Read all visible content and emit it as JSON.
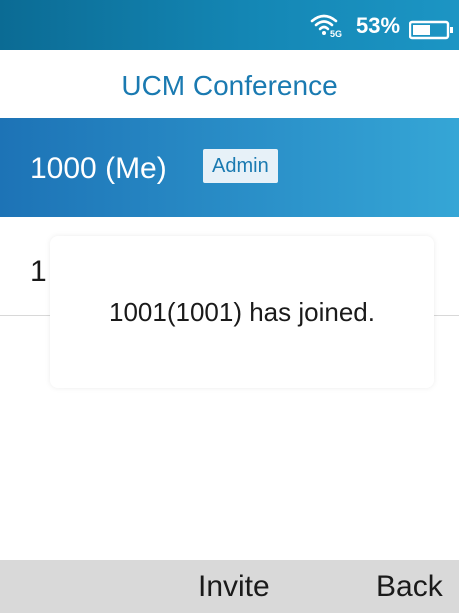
{
  "status_bar": {
    "network_label": "5G",
    "battery_percent": "53%",
    "battery_level": 0.53,
    "wifi_icon": "wifi-5g-icon",
    "battery_icon": "battery-icon"
  },
  "header": {
    "title": "UCM Conference"
  },
  "participants": [
    {
      "name": "1000 (Me)",
      "badge": "Admin",
      "selected": true
    },
    {
      "name": "1",
      "badge": "",
      "selected": false
    }
  ],
  "toast": {
    "message": "1001(1001) has joined."
  },
  "softkeys": {
    "middle": "Invite",
    "right": "Back"
  },
  "colors": {
    "accent": "#1a7ab1",
    "selected_row_start": "#1d73b6",
    "selected_row_end": "#35a6d6",
    "status_bar": "#1487b5",
    "softkey_bar": "#d9d9d9"
  }
}
